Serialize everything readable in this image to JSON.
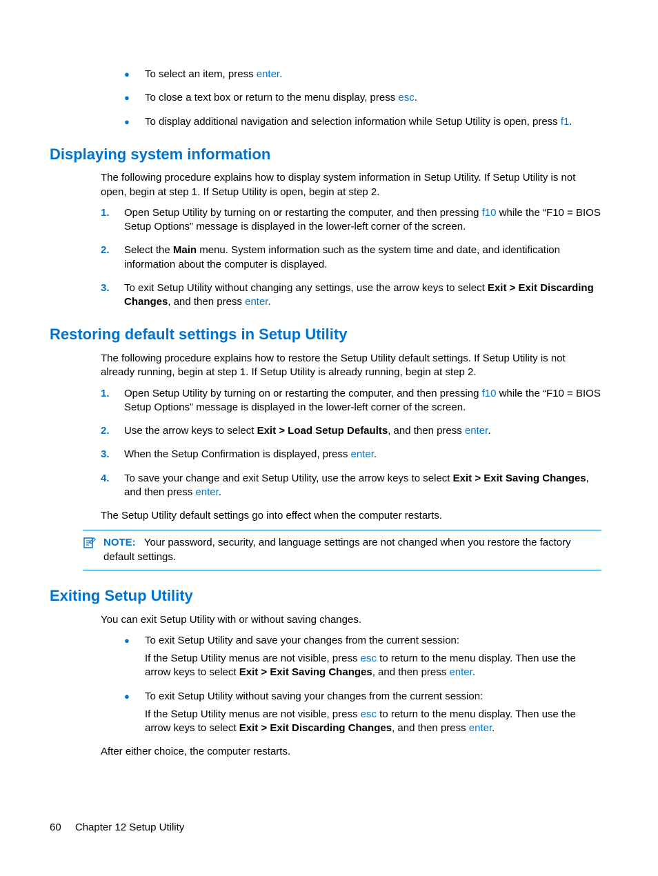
{
  "intro_bullets": [
    {
      "pre": "To select an item, press ",
      "key": "enter",
      "post": "."
    },
    {
      "pre": "To close a text box or return to the menu display, press ",
      "key": "esc",
      "post": "."
    },
    {
      "pre": "To display additional navigation and selection information while Setup Utility is open, press ",
      "key": "f1",
      "post": "."
    }
  ],
  "section1": {
    "title": "Displaying system information",
    "para": "The following procedure explains how to display system information in Setup Utility. If Setup Utility is not open, begin at step 1. If Setup Utility is open, begin at step 2.",
    "steps": {
      "s1_a": "Open Setup Utility by turning on or restarting the computer, and then pressing ",
      "s1_key": "f10",
      "s1_b": " while the “F10 = BIOS Setup Options” message is displayed in the lower-left corner of the screen.",
      "s2_a": "Select the ",
      "s2_bold": "Main",
      "s2_b": " menu. System information such as the system time and date, and identification information about the computer is displayed.",
      "s3_a": "To exit Setup Utility without changing any settings, use the arrow keys to select ",
      "s3_bold": "Exit > Exit Discarding Changes",
      "s3_b": ", and then press ",
      "s3_key": "enter",
      "s3_c": "."
    }
  },
  "section2": {
    "title": "Restoring default settings in Setup Utility",
    "para": "The following procedure explains how to restore the Setup Utility default settings. If Setup Utility is not already running, begin at step 1. If Setup Utility is already running, begin at step 2.",
    "steps": {
      "s1_a": "Open Setup Utility by turning on or restarting the computer, and then pressing ",
      "s1_key": "f10",
      "s1_b": " while the “F10 = BIOS Setup Options” message is displayed in the lower-left corner of the screen.",
      "s2_a": "Use the arrow keys to select ",
      "s2_bold": "Exit > Load Setup Defaults",
      "s2_b": ", and then press ",
      "s2_key": "enter",
      "s2_c": ".",
      "s3_a": "When the Setup Confirmation is displayed, press ",
      "s3_key": "enter",
      "s3_b": ".",
      "s4_a": "To save your change and exit Setup Utility, use the arrow keys to select ",
      "s4_bold": "Exit > Exit Saving Changes",
      "s4_b": ", and then press ",
      "s4_key": "enter",
      "s4_c": "."
    },
    "after": "The Setup Utility default settings go into effect when the computer restarts.",
    "note_label": "NOTE:",
    "note_text": "Your password, security, and language settings are not changed when you restore the factory default settings."
  },
  "section3": {
    "title": "Exiting Setup Utility",
    "para": "You can exit Setup Utility with or without saving changes.",
    "b1": {
      "lead": "To exit Setup Utility and save your changes from the current session:",
      "p_a": "If the Setup Utility menus are not visible, press ",
      "p_key1": "esc",
      "p_b": " to return to the menu display. Then use the arrow keys to select ",
      "p_bold": "Exit > Exit Saving Changes",
      "p_c": ", and then press ",
      "p_key2": "enter",
      "p_d": "."
    },
    "b2": {
      "lead": "To exit Setup Utility without saving your changes from the current session:",
      "p_a": "If the Setup Utility menus are not visible, press ",
      "p_key1": "esc",
      "p_b": " to return to the menu display. Then use the arrow keys to select ",
      "p_bold": "Exit > Exit Discarding Changes",
      "p_c": ", and then press ",
      "p_key2": "enter",
      "p_d": "."
    },
    "after": "After either choice, the computer restarts."
  },
  "footer": {
    "page": "60",
    "chapter": "Chapter 12   Setup Utility"
  }
}
